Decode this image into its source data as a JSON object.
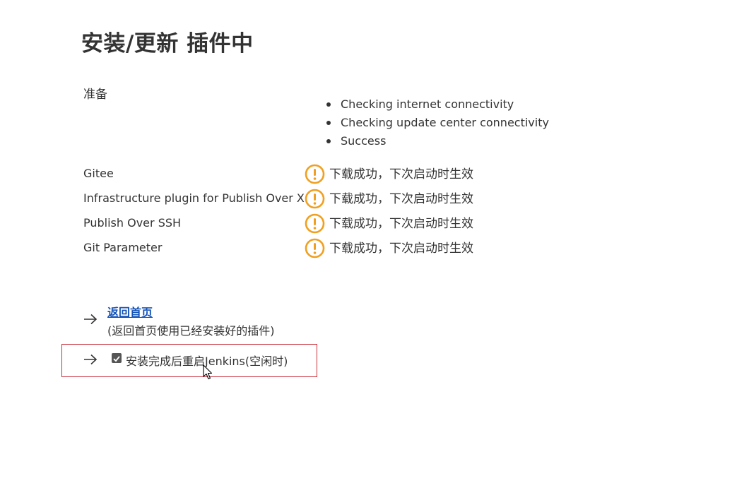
{
  "page": {
    "title": "安装/更新 插件中"
  },
  "preparation": {
    "label": "准备",
    "steps": [
      "Checking internet connectivity",
      "Checking update center connectivity",
      "Success"
    ]
  },
  "plugins": [
    {
      "name": "Gitee",
      "status": "下载成功，下次启动时生效",
      "status_icon": "warning-circle-icon"
    },
    {
      "name": "Infrastructure plugin for Publish Over X",
      "status": "下载成功，下次启动时生效",
      "status_icon": "warning-circle-icon"
    },
    {
      "name": "Publish Over SSH",
      "status": "下载成功，下次启动时生效",
      "status_icon": "warning-circle-icon"
    },
    {
      "name": "Git Parameter",
      "status": "下载成功，下次启动时生效",
      "status_icon": "warning-circle-icon"
    }
  ],
  "actions": {
    "home_link": "返回首页",
    "home_description": "(返回首页使用已经安装好的插件)",
    "restart_label": "安装完成后重启Jenkins(空闲时)",
    "restart_checked": true
  },
  "colors": {
    "warning": "#f0a020",
    "link": "#1453b8",
    "highlight_border": "#c8323c",
    "text": "#333333"
  }
}
